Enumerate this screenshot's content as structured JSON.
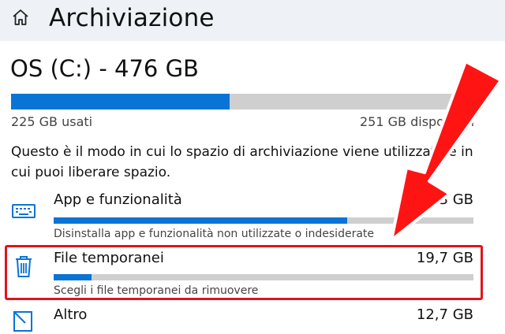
{
  "header": {
    "title": "Archiviazione",
    "icon": "home-icon"
  },
  "drive": {
    "title": "OS (C:) - 476 GB",
    "used_label": "225 GB usati",
    "free_label": "251 GB disponibili",
    "used_fraction": 0.4727
  },
  "description": "Questo è il modo in cui lo spazio di archiviazione viene utilizzato e in cui puoi liberare spazio.",
  "items": [
    {
      "name": "App e funzionalità",
      "size": "23,3 GB",
      "description": "Disinstalla app e funzionalità non utilizzate o indesiderate",
      "fraction": 0.7,
      "icon": "keyboard-icon"
    },
    {
      "name": "File temporanei",
      "size": "19,7 GB",
      "description": "Scegli i file temporanei da rimuovere",
      "fraction": 0.09,
      "icon": "trash-icon"
    },
    {
      "name": "Altro",
      "size": "12,7 GB",
      "icon": "other-icon"
    }
  ],
  "colors": {
    "accent": "#0a74d6",
    "bar_bg": "#cfcfcf",
    "annotation": "#e0141c",
    "header_bg": "#eef2f6"
  }
}
